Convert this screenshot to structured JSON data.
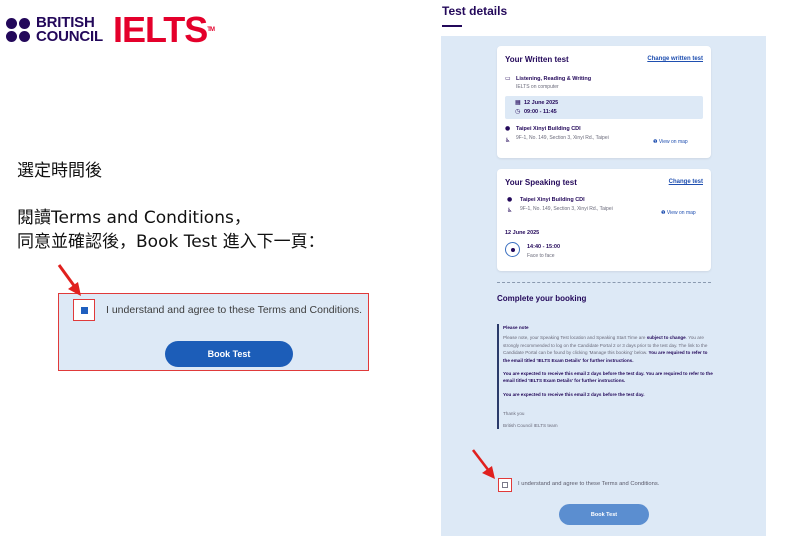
{
  "logo": {
    "brand_line1": "BRITISH",
    "brand_line2": "COUNCIL",
    "product": "IELTS",
    "tm": "TM"
  },
  "instructions": {
    "step1": "選定時間後",
    "step2_line1": "閱讀Terms and Conditions，",
    "step2_line2": "同意並確認後，Book Test 進入下一頁："
  },
  "zoom": {
    "agree_text": "I understand and agree to these Terms and Conditions.",
    "book_button": "Book Test"
  },
  "test_details": {
    "heading": "Test details",
    "written": {
      "title": "Your Written test",
      "change_link": "Change written test",
      "type": "Listening, Reading & Writing",
      "mode": "IELTS on computer",
      "date": "12 June 2025",
      "time": "09:00 - 11:45",
      "venue": "Taipei Xinyi Building CDI",
      "address": "9F-1, No. 149, Section 3, Xinyi Rd., Taipei",
      "map_link": "View on map"
    },
    "speaking": {
      "title": "Your Speaking test",
      "change_link": "Change test",
      "venue": "Taipei Xinyi Building CDI",
      "address": "9F-1, No. 149, Section 3, Xinyi Rd., Taipei",
      "map_link": "View on map",
      "date": "12 June 2025",
      "time": "14:40 - 15:00",
      "format": "Face to face"
    },
    "complete": {
      "title": "Complete your booking",
      "note_heading": "Please note",
      "note_p1_a": "Please note, your Speaking Test location and Speaking Start Time are ",
      "note_p1_bold1": "subject to change",
      "note_p1_b": ". You are strongly recommended to log on the Candidate Portal 2 or 3 days prior to the test day. The link to the Candidate Portal can be found by clicking 'Manage this booking' below. ",
      "note_p1_bold2": "You are required to refer to the email titled 'IELTS Exam Details' for further instructions.",
      "note_p2": "You are expected to receive this email 2 days before the test day. You are required to refer to the email titled 'IELTS Exam Details' for further instructions.",
      "note_p3": "You are expected to receive this email 2 days before the test day.",
      "thanks": "Thank you",
      "signature": "British Council IELTS team",
      "agree_text": "I understand and agree to these Terms and Conditions.",
      "book_button": "Book Test"
    }
  }
}
